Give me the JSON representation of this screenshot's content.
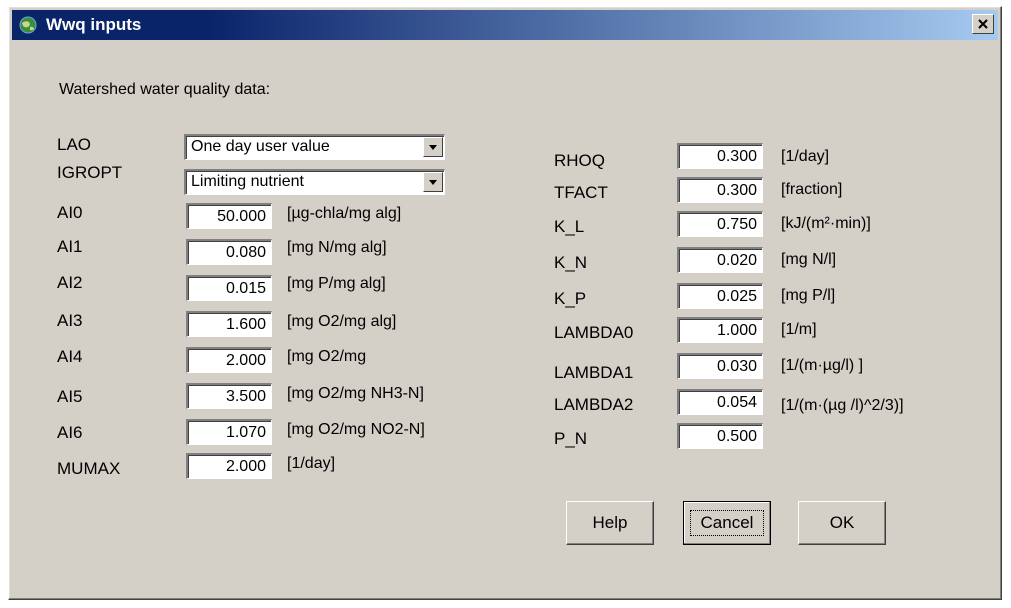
{
  "window": {
    "title": "Wwq inputs"
  },
  "heading": "Watershed water quality data:",
  "left": {
    "lao": {
      "label": "LAO",
      "value": "One day user value"
    },
    "igropt": {
      "label": "IGROPT",
      "value": "Limiting nutrient"
    },
    "params": [
      {
        "label": "AI0",
        "value": "50.000",
        "unit": "[µg-chla/mg alg]"
      },
      {
        "label": "AI1",
        "value": "0.080",
        "unit": "[mg N/mg alg]"
      },
      {
        "label": "AI2",
        "value": "0.015",
        "unit": "[mg P/mg alg]"
      },
      {
        "label": "AI3",
        "value": "1.600",
        "unit": "[mg O2/mg alg]"
      },
      {
        "label": "AI4",
        "value": "2.000",
        "unit": "[mg O2/mg"
      },
      {
        "label": "AI5",
        "value": "3.500",
        "unit": "[mg O2/mg NH3-N]"
      },
      {
        "label": "AI6",
        "value": "1.070",
        "unit": "[mg O2/mg NO2-N]"
      },
      {
        "label": "MUMAX",
        "value": "2.000",
        "unit": "[1/day]"
      }
    ]
  },
  "right": {
    "params": [
      {
        "label": "RHOQ",
        "value": "0.300",
        "unit": "[1/day]"
      },
      {
        "label": "TFACT",
        "value": "0.300",
        "unit": "[fraction]"
      },
      {
        "label": "K_L",
        "value": "0.750",
        "unit": "[kJ/(m²·min)]"
      },
      {
        "label": "K_N",
        "value": "0.020",
        "unit": "[mg N/l]"
      },
      {
        "label": "K_P",
        "value": "0.025",
        "unit": "[mg P/l]"
      },
      {
        "label": "LAMBDA0",
        "value": "1.000",
        "unit": "[1/m]"
      },
      {
        "label": "LAMBDA1",
        "value": "0.030",
        "unit": "[1/(m·µg/l) ]"
      },
      {
        "label": "LAMBDA2",
        "value": "0.054",
        "unit": "[1/(m·(µg /l)^2/3)]"
      },
      {
        "label": "P_N",
        "value": "0.500",
        "unit": ""
      }
    ]
  },
  "buttons": {
    "help": "Help",
    "cancel": "Cancel",
    "ok": "OK"
  },
  "icons": {
    "app": "globe-icon",
    "close": "close-icon",
    "dropdown": "dropdown-arrow-icon"
  },
  "colors": {
    "titlebar_start": "#0a246a",
    "titlebar_end": "#a6caf0",
    "face": "#d4d0c8"
  }
}
